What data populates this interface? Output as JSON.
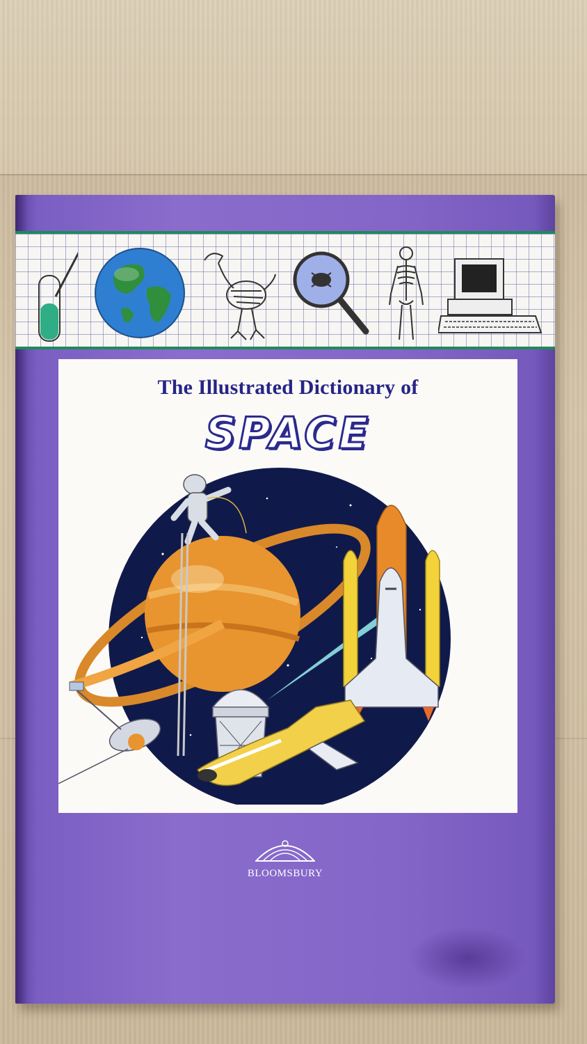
{
  "cover": {
    "title_line": "The Illustrated Dictionary of",
    "main_title": "SPACE",
    "publisher": "BLOOMSBURY"
  },
  "icons": {
    "band": [
      "test-tube-icon",
      "globe-icon",
      "bird-skeleton-icon",
      "magnifier-icon",
      "human-skeleton-icon",
      "computer-icon"
    ],
    "illustration": [
      "ringed-planet",
      "astronaut",
      "space-shuttle-launch",
      "observatory",
      "satellite",
      "orbiter",
      "comet"
    ],
    "logo": "bloomsbury-logo-icon"
  },
  "colors": {
    "cover_purple": "#8466c8",
    "title_navy": "#272487",
    "band_green": "#1f8a5a",
    "planet_orange": "#e8952f",
    "space_blue": "#101a4a"
  }
}
